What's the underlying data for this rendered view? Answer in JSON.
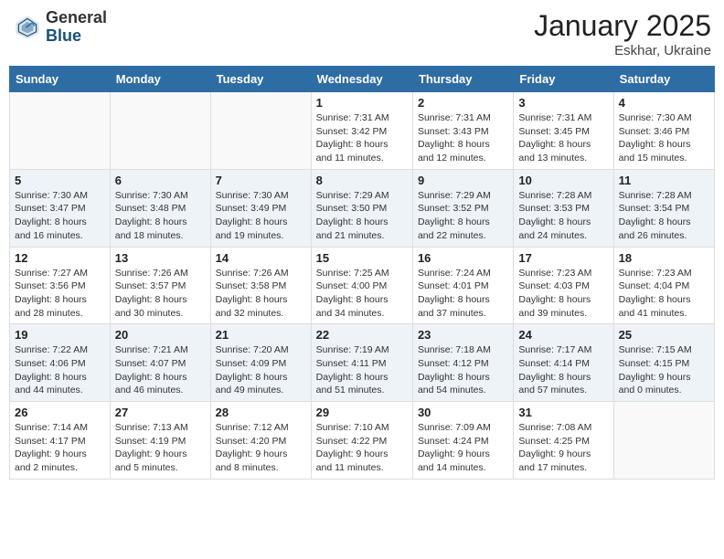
{
  "header": {
    "logo_general": "General",
    "logo_blue": "Blue",
    "month": "January 2025",
    "location": "Eskhar, Ukraine"
  },
  "weekdays": [
    "Sunday",
    "Monday",
    "Tuesday",
    "Wednesday",
    "Thursday",
    "Friday",
    "Saturday"
  ],
  "weeks": [
    [
      {
        "day": "",
        "detail": ""
      },
      {
        "day": "",
        "detail": ""
      },
      {
        "day": "",
        "detail": ""
      },
      {
        "day": "1",
        "detail": "Sunrise: 7:31 AM\nSunset: 3:42 PM\nDaylight: 8 hours\nand 11 minutes."
      },
      {
        "day": "2",
        "detail": "Sunrise: 7:31 AM\nSunset: 3:43 PM\nDaylight: 8 hours\nand 12 minutes."
      },
      {
        "day": "3",
        "detail": "Sunrise: 7:31 AM\nSunset: 3:45 PM\nDaylight: 8 hours\nand 13 minutes."
      },
      {
        "day": "4",
        "detail": "Sunrise: 7:30 AM\nSunset: 3:46 PM\nDaylight: 8 hours\nand 15 minutes."
      }
    ],
    [
      {
        "day": "5",
        "detail": "Sunrise: 7:30 AM\nSunset: 3:47 PM\nDaylight: 8 hours\nand 16 minutes."
      },
      {
        "day": "6",
        "detail": "Sunrise: 7:30 AM\nSunset: 3:48 PM\nDaylight: 8 hours\nand 18 minutes."
      },
      {
        "day": "7",
        "detail": "Sunrise: 7:30 AM\nSunset: 3:49 PM\nDaylight: 8 hours\nand 19 minutes."
      },
      {
        "day": "8",
        "detail": "Sunrise: 7:29 AM\nSunset: 3:50 PM\nDaylight: 8 hours\nand 21 minutes."
      },
      {
        "day": "9",
        "detail": "Sunrise: 7:29 AM\nSunset: 3:52 PM\nDaylight: 8 hours\nand 22 minutes."
      },
      {
        "day": "10",
        "detail": "Sunrise: 7:28 AM\nSunset: 3:53 PM\nDaylight: 8 hours\nand 24 minutes."
      },
      {
        "day": "11",
        "detail": "Sunrise: 7:28 AM\nSunset: 3:54 PM\nDaylight: 8 hours\nand 26 minutes."
      }
    ],
    [
      {
        "day": "12",
        "detail": "Sunrise: 7:27 AM\nSunset: 3:56 PM\nDaylight: 8 hours\nand 28 minutes."
      },
      {
        "day": "13",
        "detail": "Sunrise: 7:26 AM\nSunset: 3:57 PM\nDaylight: 8 hours\nand 30 minutes."
      },
      {
        "day": "14",
        "detail": "Sunrise: 7:26 AM\nSunset: 3:58 PM\nDaylight: 8 hours\nand 32 minutes."
      },
      {
        "day": "15",
        "detail": "Sunrise: 7:25 AM\nSunset: 4:00 PM\nDaylight: 8 hours\nand 34 minutes."
      },
      {
        "day": "16",
        "detail": "Sunrise: 7:24 AM\nSunset: 4:01 PM\nDaylight: 8 hours\nand 37 minutes."
      },
      {
        "day": "17",
        "detail": "Sunrise: 7:23 AM\nSunset: 4:03 PM\nDaylight: 8 hours\nand 39 minutes."
      },
      {
        "day": "18",
        "detail": "Sunrise: 7:23 AM\nSunset: 4:04 PM\nDaylight: 8 hours\nand 41 minutes."
      }
    ],
    [
      {
        "day": "19",
        "detail": "Sunrise: 7:22 AM\nSunset: 4:06 PM\nDaylight: 8 hours\nand 44 minutes."
      },
      {
        "day": "20",
        "detail": "Sunrise: 7:21 AM\nSunset: 4:07 PM\nDaylight: 8 hours\nand 46 minutes."
      },
      {
        "day": "21",
        "detail": "Sunrise: 7:20 AM\nSunset: 4:09 PM\nDaylight: 8 hours\nand 49 minutes."
      },
      {
        "day": "22",
        "detail": "Sunrise: 7:19 AM\nSunset: 4:11 PM\nDaylight: 8 hours\nand 51 minutes."
      },
      {
        "day": "23",
        "detail": "Sunrise: 7:18 AM\nSunset: 4:12 PM\nDaylight: 8 hours\nand 54 minutes."
      },
      {
        "day": "24",
        "detail": "Sunrise: 7:17 AM\nSunset: 4:14 PM\nDaylight: 8 hours\nand 57 minutes."
      },
      {
        "day": "25",
        "detail": "Sunrise: 7:15 AM\nSunset: 4:15 PM\nDaylight: 9 hours\nand 0 minutes."
      }
    ],
    [
      {
        "day": "26",
        "detail": "Sunrise: 7:14 AM\nSunset: 4:17 PM\nDaylight: 9 hours\nand 2 minutes."
      },
      {
        "day": "27",
        "detail": "Sunrise: 7:13 AM\nSunset: 4:19 PM\nDaylight: 9 hours\nand 5 minutes."
      },
      {
        "day": "28",
        "detail": "Sunrise: 7:12 AM\nSunset: 4:20 PM\nDaylight: 9 hours\nand 8 minutes."
      },
      {
        "day": "29",
        "detail": "Sunrise: 7:10 AM\nSunset: 4:22 PM\nDaylight: 9 hours\nand 11 minutes."
      },
      {
        "day": "30",
        "detail": "Sunrise: 7:09 AM\nSunset: 4:24 PM\nDaylight: 9 hours\nand 14 minutes."
      },
      {
        "day": "31",
        "detail": "Sunrise: 7:08 AM\nSunset: 4:25 PM\nDaylight: 9 hours\nand 17 minutes."
      },
      {
        "day": "",
        "detail": ""
      }
    ]
  ]
}
